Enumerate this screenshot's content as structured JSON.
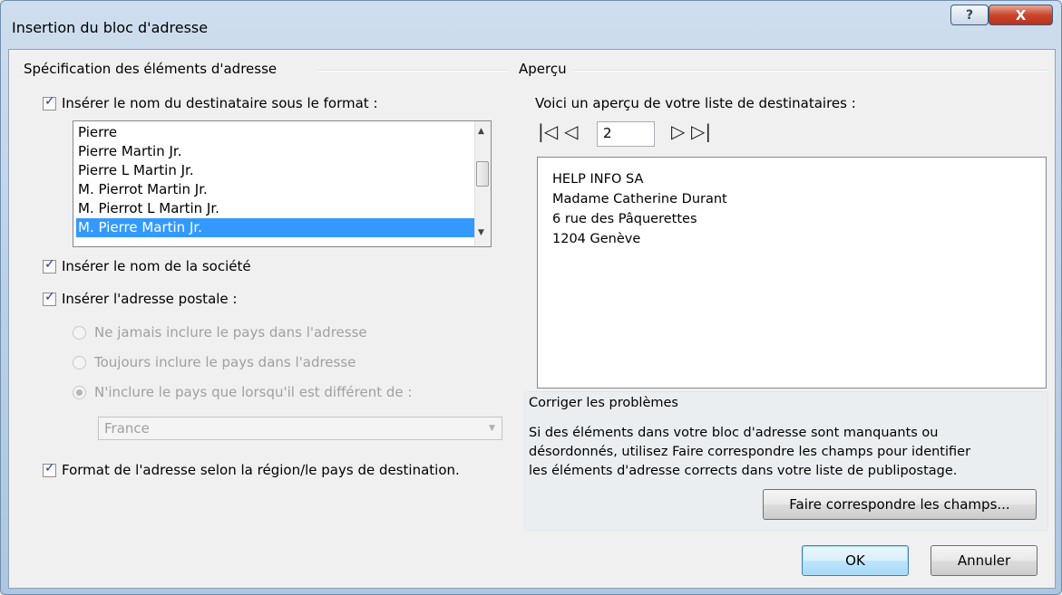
{
  "window": {
    "title": "Insertion du bloc d'adresse",
    "help_label": "?",
    "close_label": "X"
  },
  "left": {
    "group_title": "Spécification des éléments d'adresse",
    "insert_name": {
      "label": "Insérer le nom du destinataire sous le format :",
      "checked": true
    },
    "name_formats": [
      "Pierre",
      "Pierre Martin Jr.",
      "Pierre L Martin Jr.",
      "M. Pierrot Martin Jr.",
      "M. Pierrot L Martin Jr.",
      "M. Pierre Martin Jr."
    ],
    "selected_format": "M. Pierre Martin Jr.",
    "insert_company": {
      "label": "Insérer le nom de la société",
      "checked": true
    },
    "insert_postal": {
      "label": "Insérer l'adresse postale :",
      "checked": true
    },
    "country_options": [
      {
        "label": "Ne jamais inclure le pays dans l'adresse",
        "selected": false
      },
      {
        "label": "Toujours inclure le pays dans l'adresse",
        "selected": false
      },
      {
        "label": "N'inclure le pays que lorsqu'il est différent de :",
        "selected": true
      }
    ],
    "country_value": "France",
    "format_by_region": {
      "label": "Format de l'adresse selon la région/le pays de destination.",
      "checked": true
    }
  },
  "right": {
    "group_title": "Aperçu",
    "intro": "Voici un aperçu de votre liste de destinataires :",
    "nav": {
      "first_icon": "first-record-icon",
      "prev_icon": "previous-record-icon",
      "next_icon": "next-record-icon",
      "last_icon": "last-record-icon"
    },
    "record_number": "2",
    "preview_lines": [
      "HELP INFO SA",
      "Madame Catherine Durant",
      "6 rue des Pâquerettes",
      "1204 Genève"
    ],
    "fix_title": "Corriger les problèmes",
    "fix_text": [
      "Si des éléments dans votre bloc d'adresse sont manquants ou",
      "désordonnés, utilisez Faire correspondre les champs pour identifier",
      "les éléments d'adresse corrects dans votre liste de publipostage."
    ],
    "match_fields_label": "Faire correspondre les champs..."
  },
  "buttons": {
    "ok": "OK",
    "cancel": "Annuler"
  }
}
